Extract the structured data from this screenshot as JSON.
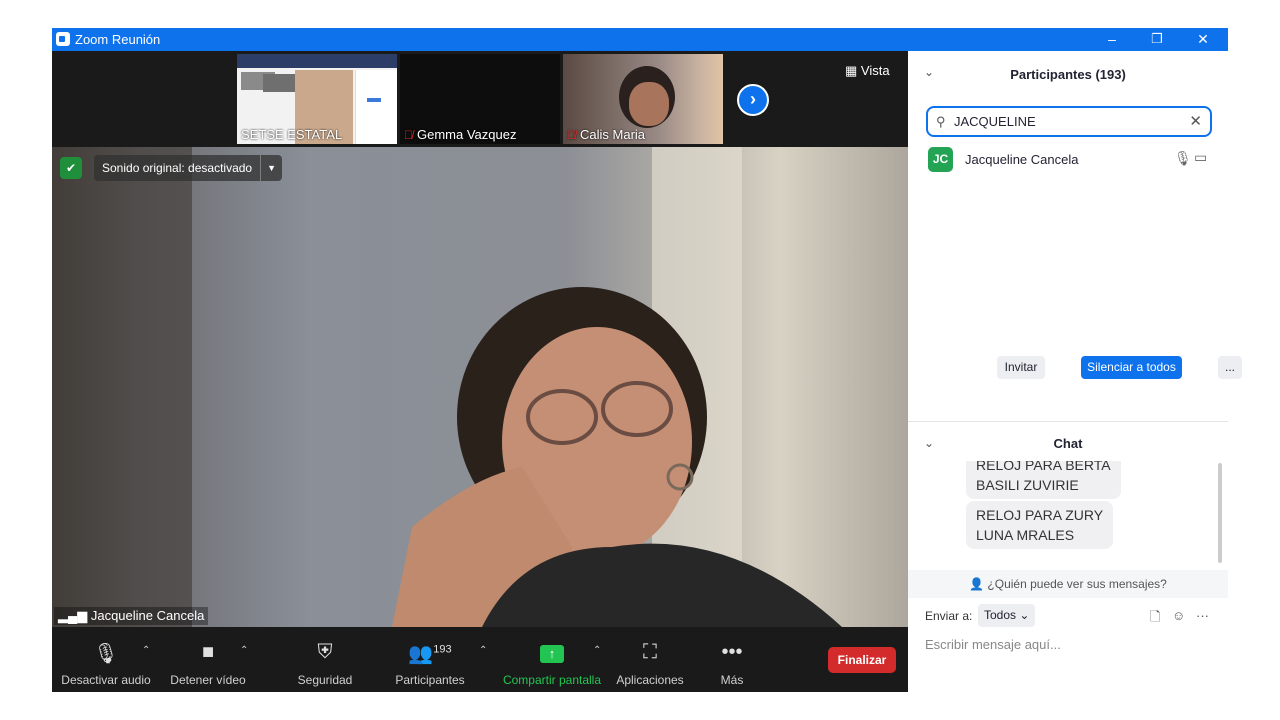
{
  "window": {
    "title": "Zoom Reunión",
    "minimize": "–",
    "restore": "❐",
    "close": "✕"
  },
  "thumbnails": [
    {
      "name": "SETSE ESTATAL",
      "muted": false
    },
    {
      "name": "Gemma Vazquez",
      "muted": true
    },
    {
      "name": "Calis Maria",
      "muted": true
    }
  ],
  "view_button": "Vista",
  "main_video": {
    "sound_original": "Sonido original: desactivado",
    "speaker_name": "Jacqueline Cancela"
  },
  "toolbar": {
    "mute": "Desactivar audio",
    "video": "Detener vídeo",
    "security": "Seguridad",
    "participants": "Participantes",
    "participant_count": "193",
    "share": "Compartir pantalla",
    "apps": "Aplicaciones",
    "more": "Más",
    "end": "Finalizar"
  },
  "participants_panel": {
    "title": "Participantes (193)",
    "search_value": "JACQUELINE",
    "results": [
      {
        "initials": "JC",
        "name": "Jacqueline Cancela"
      }
    ],
    "invite": "Invitar",
    "mute_all": "Silenciar a todos",
    "more": "..."
  },
  "chat": {
    "title": "Chat",
    "messages": [
      {
        "line1": "RELOJ PARA BERTA",
        "line2": "BASILI ZUVIRIE"
      },
      {
        "line1": "RELOJ PARA ZURY",
        "line2": "LUNA MRALES"
      }
    ],
    "who_can_see": "¿Quién puede ver sus mensajes?",
    "send_to_label": "Enviar a:",
    "send_to_value": "Todos",
    "input_placeholder": "Escribir mensaje aquí..."
  },
  "colors": {
    "titlebar": "#0e72ed",
    "end_button": "#d32b2b",
    "share_green": "#23c552",
    "avatar_green": "#23a455"
  }
}
